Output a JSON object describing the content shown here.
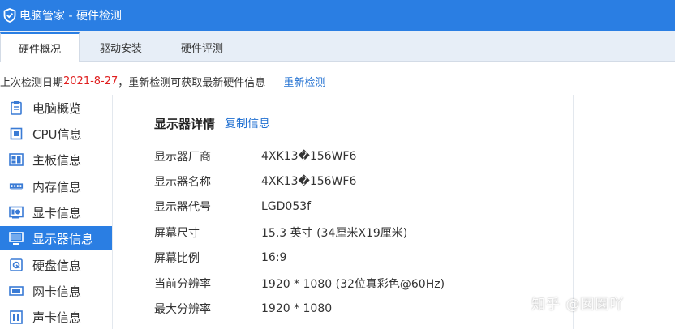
{
  "window": {
    "title": "电脑管家 - 硬件检测"
  },
  "tabs": [
    {
      "label": "硬件概况",
      "active": true
    },
    {
      "label": "驱动安装",
      "active": false
    },
    {
      "label": "硬件评测",
      "active": false
    }
  ],
  "info": {
    "prefix": "上次检测日期 ",
    "date": "2021-8-27",
    "suffix": "，重新检测可获取最新硬件信息",
    "recheck_label": "重新检测"
  },
  "sidebar": {
    "items": [
      {
        "label": "电脑概览",
        "icon": "clipboard-icon",
        "active": false
      },
      {
        "label": "CPU信息",
        "icon": "cpu-icon",
        "active": false
      },
      {
        "label": "主板信息",
        "icon": "motherboard-icon",
        "active": false
      },
      {
        "label": "内存信息",
        "icon": "memory-icon",
        "active": false
      },
      {
        "label": "显卡信息",
        "icon": "graphics-card-icon",
        "active": false
      },
      {
        "label": "显示器信息",
        "icon": "monitor-icon",
        "active": true
      },
      {
        "label": "硬盘信息",
        "icon": "hard-disk-icon",
        "active": false
      },
      {
        "label": "网卡信息",
        "icon": "network-card-icon",
        "active": false
      },
      {
        "label": "声卡信息",
        "icon": "sound-card-icon",
        "active": false
      }
    ]
  },
  "main": {
    "section_title": "显示器详情",
    "copy_label": "复制信息",
    "rows": [
      {
        "key": "显示器厂商",
        "value": "4XK13�156WF6"
      },
      {
        "key": "显示器名称",
        "value": "4XK13�156WF6"
      },
      {
        "key": "显示器代号",
        "value": "LGD053f"
      },
      {
        "key": "屏幕尺寸",
        "value": "15.3 英寸 (34厘米X19厘米)"
      },
      {
        "key": "屏幕比例",
        "value": "16:9"
      },
      {
        "key": "当前分辨率",
        "value": "1920 * 1080 (32位真彩色@60Hz)"
      },
      {
        "key": "最大分辨率",
        "value": "1920 * 1080"
      }
    ]
  },
  "watermark": "知乎 @囡囡吖",
  "colors": {
    "accent": "#2a7ee3",
    "link": "#1f6fd1",
    "date": "#e02020"
  }
}
